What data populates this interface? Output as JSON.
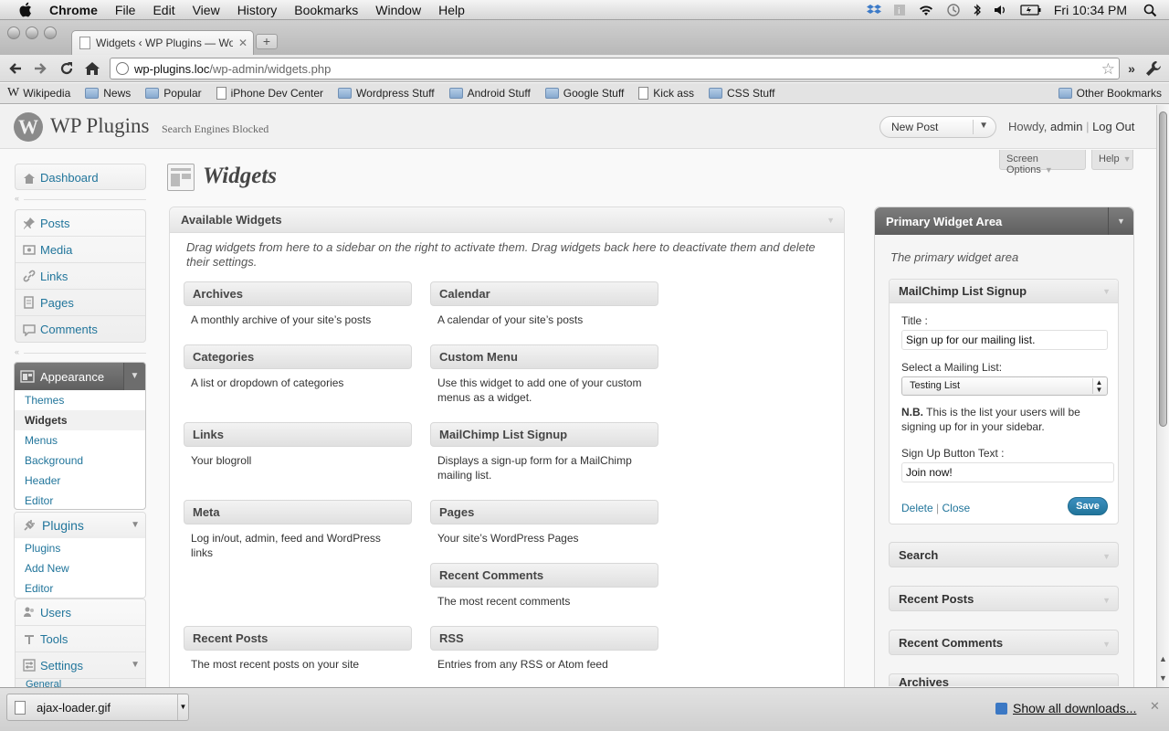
{
  "menubar": {
    "app": "Chrome",
    "items": [
      "File",
      "Edit",
      "View",
      "History",
      "Bookmarks",
      "Window",
      "Help"
    ],
    "clock": "Fri 10:34 PM"
  },
  "browser": {
    "tab_title": "Widgets ‹ WP Plugins — WordPress",
    "url_domain": "wp-plugins.loc",
    "url_path": "/wp-admin/widgets.php",
    "bookmarks": [
      "Wikipedia",
      "News",
      "Popular",
      "iPhone Dev Center",
      "Wordpress Stuff",
      "Android Stuff",
      "Google Stuff",
      "Kick ass",
      "CSS Stuff"
    ],
    "other_bookmarks": "Other Bookmarks"
  },
  "wp_header": {
    "logo_letter": "W",
    "site_name": "WP Plugins",
    "blocked_notice": "Search Engines Blocked",
    "favorite_action": "New Post",
    "howdy": "Howdy,",
    "user": "admin",
    "logout": "Log Out"
  },
  "screen_meta": {
    "screen_options": "Screen Options",
    "help": "Help"
  },
  "sidebar": {
    "dashboard": "Dashboard",
    "group1": [
      "Posts",
      "Media",
      "Links",
      "Pages",
      "Comments"
    ],
    "appearance": "Appearance",
    "appearance_sub": [
      "Themes",
      "Widgets",
      "Menus",
      "Background",
      "Header",
      "Editor"
    ],
    "plugins": "Plugins",
    "plugins_sub": [
      "Plugins",
      "Add New",
      "Editor"
    ],
    "group3": [
      "Users",
      "Tools",
      "Settings"
    ],
    "cut_off": "General"
  },
  "main": {
    "page_title": "Widgets",
    "available_title": "Available Widgets",
    "available_desc": "Drag widgets from here to a sidebar on the right to activate them. Drag widgets back here to deactivate them and delete their settings.",
    "widgets": [
      {
        "title": "Archives",
        "desc": "A monthly archive of your site’s posts"
      },
      {
        "title": "Calendar",
        "desc": "A calendar of your site’s posts"
      },
      {
        "title": "Categories",
        "desc": "A list or dropdown of categories"
      },
      {
        "title": "Custom Menu",
        "desc": "Use this widget to add one of your custom menus as a widget."
      },
      {
        "title": "Links",
        "desc": "Your blogroll"
      },
      {
        "title": "MailChimp List Signup",
        "desc": "Displays a sign-up form for a MailChimp mailing list."
      },
      {
        "title": "Meta",
        "desc": "Log in/out, admin, feed and WordPress links"
      },
      {
        "title": "Pages",
        "desc": "Your site’s WordPress Pages"
      },
      {
        "title": "Recent Comments",
        "desc": "The most recent comments"
      },
      {
        "title": "Recent Posts",
        "desc": "The most recent posts on your site"
      },
      {
        "title": "RSS",
        "desc": "Entries from any RSS or Atom feed"
      }
    ]
  },
  "primary_area": {
    "title": "Primary Widget Area",
    "desc": "The primary widget area",
    "mailchimp": {
      "title": "MailChimp List Signup",
      "title_label": "Title :",
      "title_value": "Sign up for our mailing list.",
      "list_label": "Select a Mailing List:",
      "list_value": "Testing List",
      "note_bold": "N.B.",
      "note_text": " This is the list your users will be signing up for in your sidebar.",
      "button_label": "Sign Up Button Text :",
      "button_value": "Join now!",
      "delete": "Delete",
      "close": "Close",
      "save": "Save"
    },
    "placed": [
      "Search",
      "Recent Posts",
      "Recent Comments",
      "Archives"
    ]
  },
  "download_shelf": {
    "file": "ajax-loader.gif",
    "show_all": "Show all downloads..."
  }
}
